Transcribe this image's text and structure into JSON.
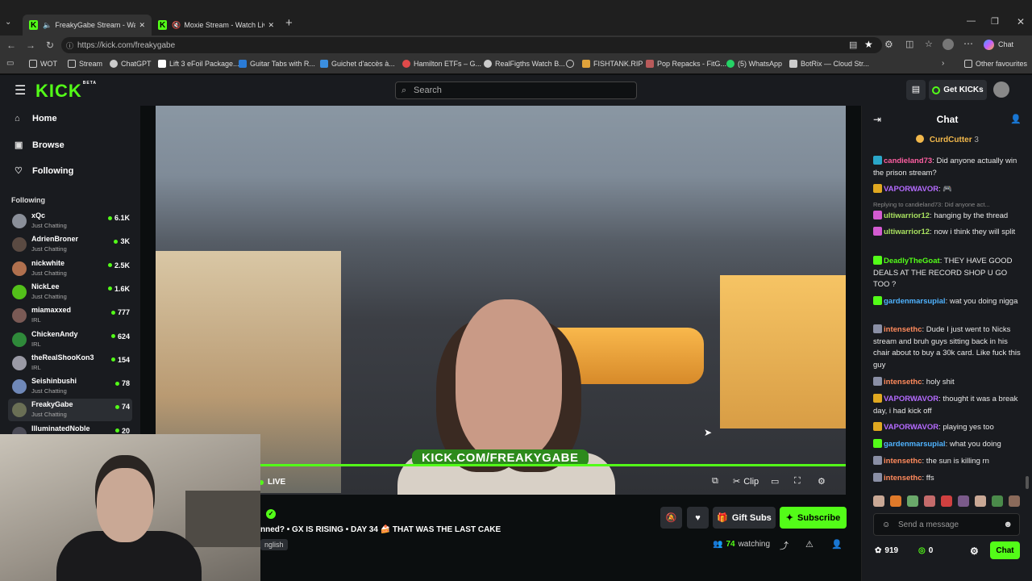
{
  "browser": {
    "tabs": [
      {
        "title": "FreakyGabe Stream - Watch Li..."
      },
      {
        "title": "Moxie Stream - Watch Live o..."
      }
    ],
    "new_tab": "+",
    "url": "https://kick.com/freakygabe",
    "chat_label": "Chat",
    "bookmarks": [
      {
        "label": "WOT"
      },
      {
        "label": "Stream"
      },
      {
        "label": "ChatGPT"
      },
      {
        "label": "Lift 3 eFoil Package..."
      },
      {
        "label": "Guitar Tabs with R..."
      },
      {
        "label": "Guichet d'accès à..."
      },
      {
        "label": "Hamilton ETFs – G..."
      },
      {
        "label": "RealFigths Watch B..."
      },
      {
        "label": ""
      },
      {
        "label": "FISHTANK.RIP"
      },
      {
        "label": "Pop Repacks - FitG..."
      },
      {
        "label": "(5) WhatsApp"
      },
      {
        "label": "BotRix — Cloud Str..."
      }
    ],
    "other_favourites": "Other favourites"
  },
  "app": {
    "logo": "KICK",
    "logo_tag": "BETA",
    "search_placeholder": "Search",
    "get_kicks": "Get KICKs"
  },
  "sidebar": {
    "nav": [
      {
        "label": "Home",
        "icon": "home-icon"
      },
      {
        "label": "Browse",
        "icon": "browse-icon"
      },
      {
        "label": "Following",
        "icon": "heart-icon"
      }
    ],
    "following_heading": "Following",
    "channels": [
      {
        "name": "xQc",
        "category": "Just Chatting",
        "viewers": "6.1K",
        "color": "#8a8f99"
      },
      {
        "name": "AdrienBroner",
        "category": "Just Chatting",
        "viewers": "3K",
        "color": "#5a4a42"
      },
      {
        "name": "nickwhite",
        "category": "Just Chatting",
        "viewers": "2.5K",
        "color": "#b0704e"
      },
      {
        "name": "NickLee",
        "category": "Just Chatting",
        "viewers": "1.6K",
        "color": "#53c01a"
      },
      {
        "name": "miamaxxed",
        "category": "IRL",
        "viewers": "777",
        "color": "#7a5a55"
      },
      {
        "name": "ChickenAndy",
        "category": "IRL",
        "viewers": "624",
        "color": "#2f8a3a"
      },
      {
        "name": "theRealShooKon3",
        "category": "IRL",
        "viewers": "154",
        "color": "#9a9aa5"
      },
      {
        "name": "Seishinbushi",
        "category": "Just Chatting",
        "viewers": "78",
        "color": "#6f88b8"
      },
      {
        "name": "FreakyGabe",
        "category": "Just Chatting",
        "viewers": "74",
        "color": "#6a6f55"
      },
      {
        "name": "IlluminatedNoble",
        "category": "",
        "viewers": "20",
        "color": "#4a4a55"
      }
    ]
  },
  "stream": {
    "watermark": "KICK.COM/FREAKYGABE",
    "live_label": "LIVE",
    "controls": {
      "clip": "Clip"
    },
    "title": "nned? • GX IS RISING • DAY 34 🍰 THAT WAS THE LAST CAKE",
    "language": "nglish",
    "gift_subs": "Gift Subs",
    "subscribe": "Subscribe",
    "watching_count": "74",
    "watching_label": "watching"
  },
  "chat": {
    "title": "Chat",
    "pinned_user": "CurdCutter",
    "pinned_count": "3",
    "messages": [
      {
        "user": "candieland73",
        "color": "#ff5fa2",
        "text": "Did anyone actually win the prison stream?",
        "badge_color": "#2aa7c9"
      },
      {
        "user": "VAPORWAVOR",
        "color": "#b56bff",
        "text": "🎮",
        "badge_color": "#e0a820"
      },
      {
        "reply": "Replying to candieland73: Did anyone act..."
      },
      {
        "user": "ultiwarrior12",
        "color": "#a8e05f",
        "text": "hanging by the thread",
        "badge_color": "#d35bd1"
      },
      {
        "user": "ultiwarrior12",
        "color": "#a8e05f",
        "text": "now i think they will split",
        "badge_color": "#d35bd1"
      },
      {
        "user": "DeadlyTheGoat",
        "color": "#53fc18",
        "text": "THEY HAVE GOOD DEALS AT THE RECORD SHOP U GO TOO ?",
        "badge_color": "#53fc18"
      },
      {
        "user": "gardenmarsupial",
        "color": "#4fb3ff",
        "text": "wat you doing nigga",
        "badge_color": "#53fc18"
      },
      {
        "user": "intensethc",
        "color": "#ff8a5c",
        "text": "Dude I just went to Nicks stream and bruh guys sitting back in his chair about to buy a 30k card. Like fuck this guy",
        "badge_color": "#8a8fa5"
      },
      {
        "user": "intensethc",
        "color": "#ff8a5c",
        "text": "holy shit",
        "badge_color": "#8a8fa5"
      },
      {
        "user": "VAPORWAVOR",
        "color": "#b56bff",
        "text": "thought it was a break day, i had kick off",
        "badge_color": "#e0a820"
      },
      {
        "user": "VAPORWAVOR",
        "color": "#b56bff",
        "text": "playing yes too",
        "badge_color": "#e0a820"
      },
      {
        "user": "gardenmarsupial",
        "color": "#4fb3ff",
        "text": "what you doing",
        "badge_color": "#53fc18"
      },
      {
        "user": "intensethc",
        "color": "#ff8a5c",
        "text": "the sun is killing rn",
        "badge_color": "#8a8fa5"
      },
      {
        "user": "intensethc",
        "color": "#ff8a5c",
        "text": "ffs",
        "badge_color": "#8a8fa5"
      }
    ],
    "input_placeholder": "Send a message",
    "points": "919",
    "kicks": "0",
    "send_label": "Chat"
  }
}
